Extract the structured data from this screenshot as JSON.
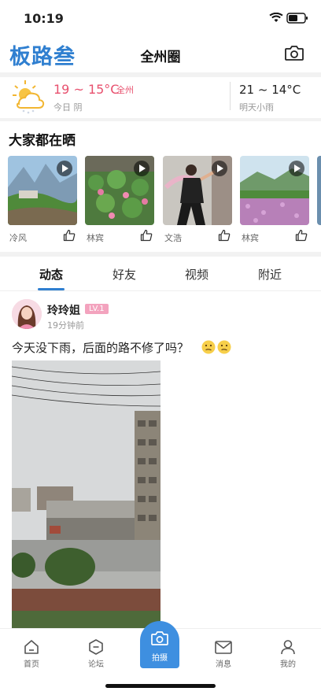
{
  "status": {
    "time": "10:19"
  },
  "nav": {
    "logo": "板路叁",
    "title": "全州圈"
  },
  "weather": {
    "today_temp": "19 ~ 15°C",
    "today_location": "全州",
    "today_desc": "今日 阴",
    "tomorrow_temp": "21 ~ 14°C",
    "tomorrow_desc": "明天小雨"
  },
  "section": {
    "title": "大家都在晒"
  },
  "cards": [
    {
      "name": "冷风"
    },
    {
      "name": "林宾"
    },
    {
      "name": "文浩"
    },
    {
      "name": "林宾"
    }
  ],
  "tabs": [
    "动态",
    "好友",
    "视频",
    "附近"
  ],
  "post": {
    "author": "玲玲姐",
    "level": "LV.1",
    "time": "19分钟前",
    "text": "今天没下雨，后面的路不修了吗？"
  },
  "bottom_nav": {
    "home": "首页",
    "forum": "论坛",
    "shoot": "拍摄",
    "messages": "消息",
    "mine": "我的"
  },
  "colors": {
    "accent": "#2f7fd0",
    "temp_today": "#e8506e",
    "level_badge": "#f3a3be"
  }
}
